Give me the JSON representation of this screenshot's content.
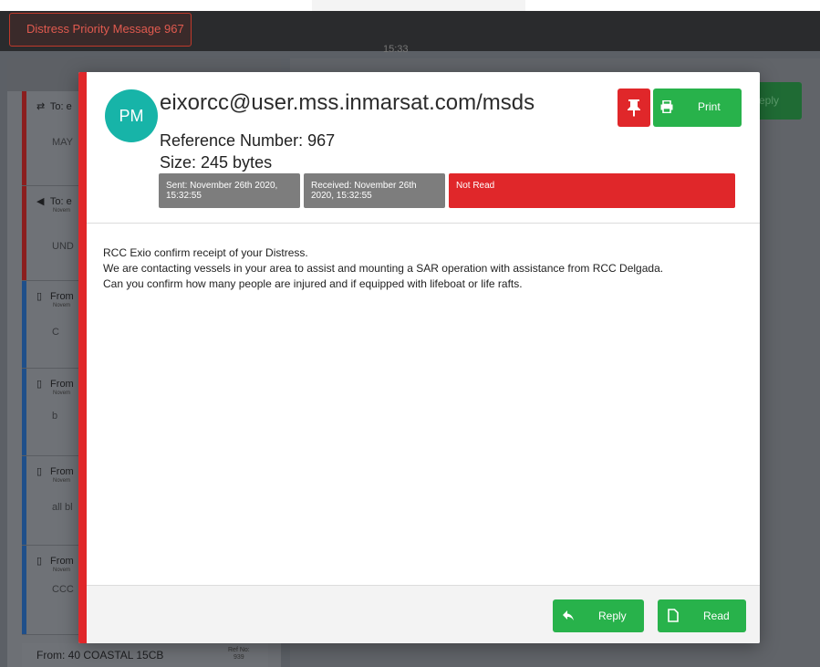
{
  "header": {
    "alert_tab": "Distress Priority Message 967",
    "clock": "15:33"
  },
  "background": {
    "list_items": [
      {
        "meta": "To: e",
        "sub": "",
        "body": "MAY",
        "bar_color": "#8b1e1e",
        "icon": "exchange-icon"
      },
      {
        "meta": "To: e",
        "sub": "Novem",
        "body": "UND",
        "bar_color": "#8b1e1e",
        "icon": "megaphone-icon"
      },
      {
        "meta": "From",
        "sub": "Novem",
        "body": "C",
        "bar_color": "#1f4f8a",
        "icon": "file-icon"
      },
      {
        "meta": "From",
        "sub": "Novem",
        "body": "b",
        "bar_color": "#1f4f8a",
        "icon": "file-icon"
      },
      {
        "meta": "From",
        "sub": "Novem",
        "body": "all bl",
        "bar_color": "#1f4f8a",
        "icon": "file-icon"
      },
      {
        "meta": "From",
        "sub": "Novem",
        "body": "CCC",
        "bar_color": "#1f4f8a",
        "icon": "file-icon"
      }
    ],
    "bottom_item": {
      "label": "From: 40 COASTAL 15CB",
      "ref_label": "Ref No:",
      "ref_value": "939"
    },
    "reply_ghost": "eply"
  },
  "modal": {
    "avatar": "PM",
    "sender": "eixorcc@user.mss.inmarsat.com/msds",
    "reference": "Reference Number: 967",
    "size": "Size: 245 bytes",
    "sent": "Sent: November 26th 2020, 15:32:55",
    "received": "Received: November 26th 2020, 15:32:55",
    "status": "Not Read",
    "print_label": "Print",
    "pin_icon": "pin-icon",
    "print_icon": "print-icon",
    "body": [
      "RCC Exio confirm receipt of your Distress.",
      "We are contacting vessels in your area to assist and mounting a SAR operation with assistance from RCC Delgada.",
      "Can you confirm how many people are injured and if equipped with lifeboat or life rafts."
    ],
    "reply_label": "Reply",
    "read_label": "Read",
    "reply_icon": "reply-icon",
    "read_icon": "file-icon"
  },
  "colors": {
    "accent_red": "#e0272a",
    "green": "#28b24b",
    "avatar_teal": "#17b4a8",
    "tag_gray": "#7d7d7d"
  }
}
